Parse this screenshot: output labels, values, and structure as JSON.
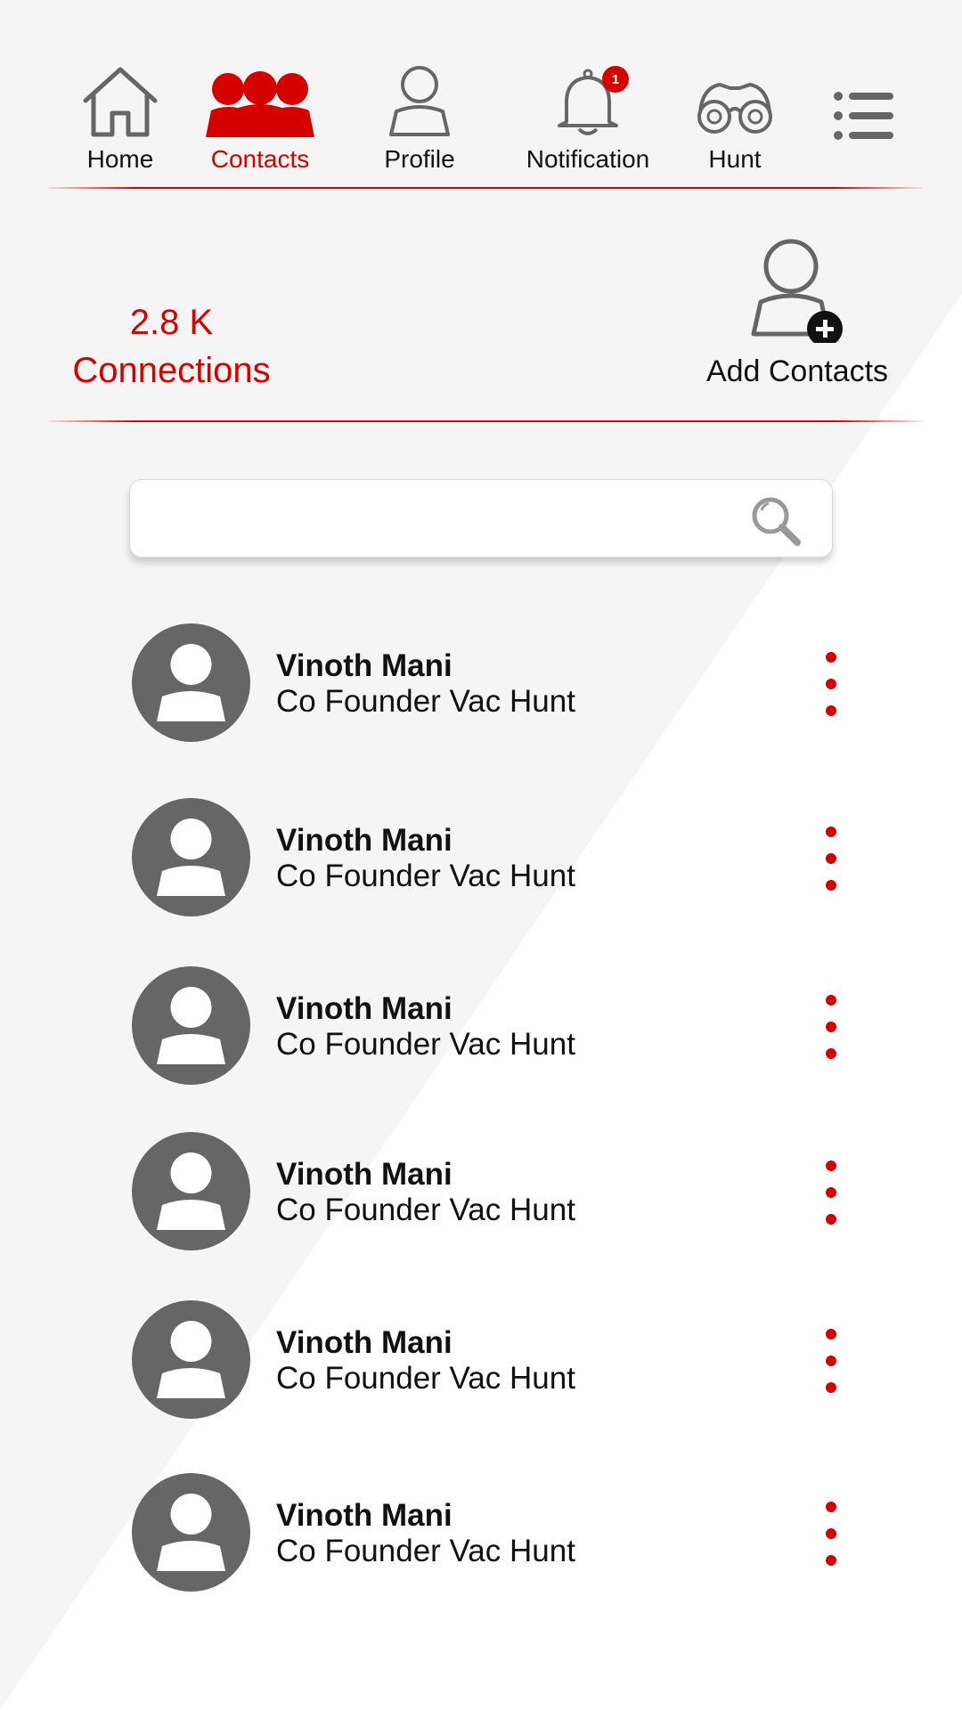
{
  "nav": {
    "home_label": "Home",
    "contacts_label": "Contacts",
    "profile_label": "Profile",
    "notification_label": "Notification",
    "notification_badge": "1",
    "hunt_label": "Hunt",
    "menu_icon": "menu-icon"
  },
  "stats": {
    "connections_count": "2.8 K",
    "connections_label": "Connections",
    "add_contacts_label": "Add Contacts"
  },
  "search": {
    "value": "",
    "placeholder": ""
  },
  "contacts": [
    {
      "name": "Vinoth Mani",
      "title": "Co Founder Vac Hunt"
    },
    {
      "name": "Vinoth Mani",
      "title": "Co Founder Vac Hunt"
    },
    {
      "name": "Vinoth Mani",
      "title": "Co Founder Vac Hunt"
    },
    {
      "name": "Vinoth Mani",
      "title": "Co Founder Vac Hunt"
    },
    {
      "name": "Vinoth Mani",
      "title": "Co Founder Vac Hunt"
    },
    {
      "name": "Vinoth Mani",
      "title": "Co Founder Vac Hunt"
    }
  ],
  "colors": {
    "accent": "#d50000",
    "icon_gray": "#666666",
    "background": "#f5f5f5"
  }
}
